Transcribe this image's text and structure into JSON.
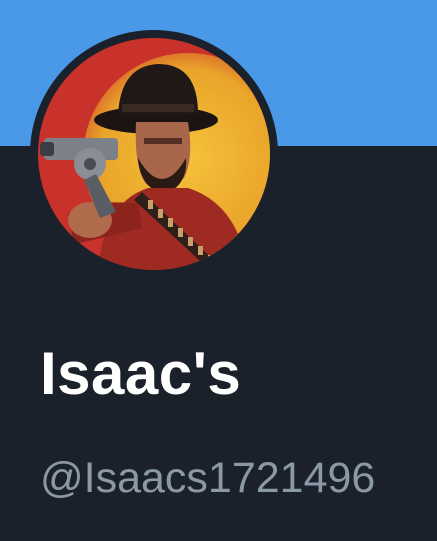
{
  "profile": {
    "display_name": "Isaac's",
    "handle": "@Isaacs1721496",
    "avatar_icon": "cowboy-gunslinger-avatar"
  },
  "colors": {
    "banner": "#4a99e9",
    "background": "#1a212b",
    "display_name": "#ffffff",
    "handle": "#8b98a5"
  }
}
